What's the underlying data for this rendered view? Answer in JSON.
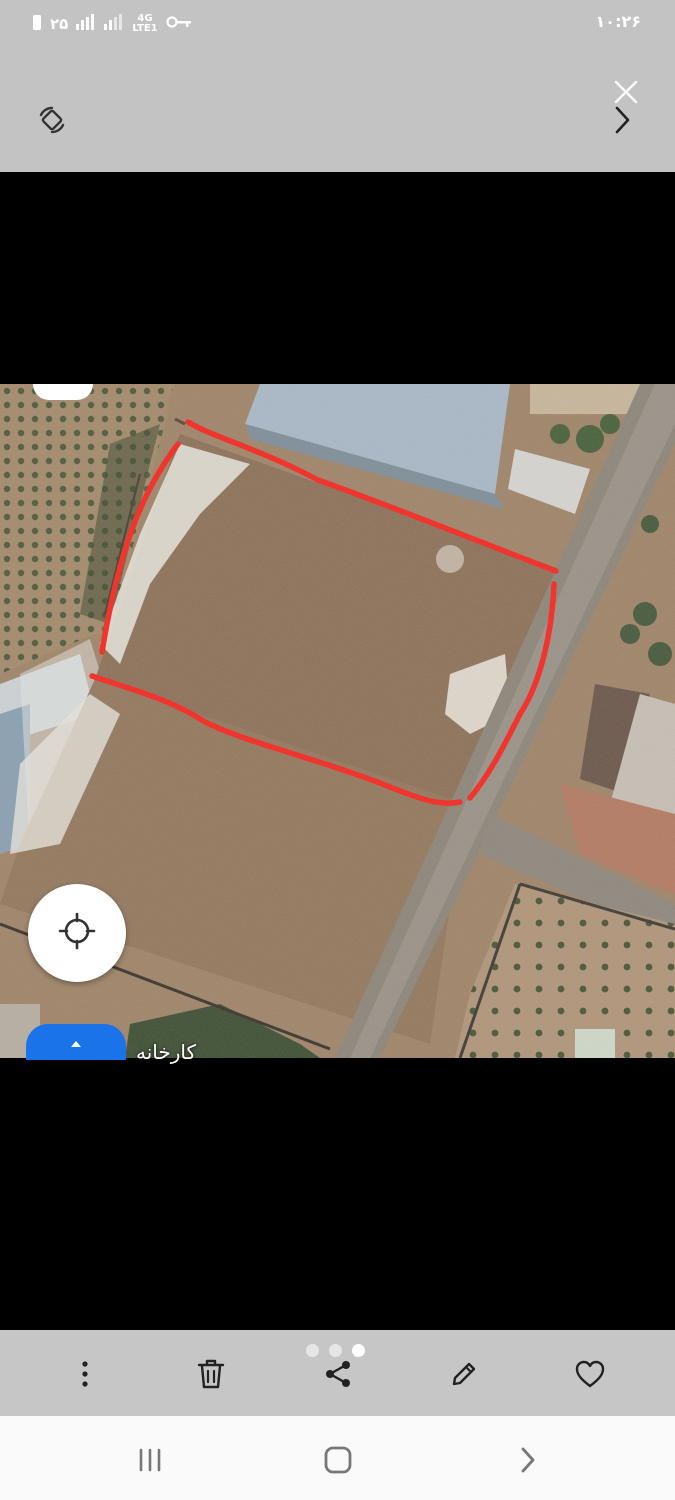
{
  "status_bar": {
    "left_number": "۲۵",
    "network_top": "4G",
    "network_bottom": "LTE1",
    "time": "۱۰:۲۶"
  },
  "top_bar": {
    "icons": [
      "rotate-icon",
      "close-icon",
      "chevron-right-icon"
    ]
  },
  "map": {
    "label": "کارخانه",
    "colors": {
      "boundary": "#f0352e",
      "fab": "#1a73e8"
    }
  },
  "pager": {
    "count": 3,
    "active_index": 2
  },
  "actions": {
    "icons": [
      "more-vert-icon",
      "trash-icon",
      "share-icon",
      "pencil-icon",
      "heart-icon"
    ]
  },
  "nav": {
    "icons": [
      "recents-icon",
      "home-icon",
      "back-icon"
    ]
  }
}
